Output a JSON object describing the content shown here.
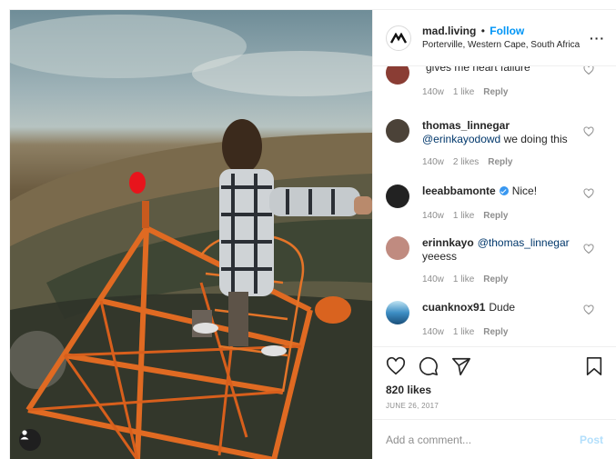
{
  "header": {
    "username": "mad.living",
    "separator": "•",
    "follow_label": "Follow",
    "location": "Porterville, Western Cape, South Africa",
    "more_label": "···"
  },
  "comments": [
    {
      "username": "",
      "text": "gives me heart failure",
      "mention": "",
      "age": "140w",
      "likes": "1 like",
      "reply_label": "Reply",
      "avatar_color": "#8a3d34"
    },
    {
      "username": "thomas_linnegar",
      "text": "we doing this",
      "mention": "@erinkayodowd",
      "age": "140w",
      "likes": "2 likes",
      "reply_label": "Reply",
      "avatar_color": "#4b4238"
    },
    {
      "username": "leeabbamonte",
      "text": "Nice!",
      "mention": "",
      "age": "140w",
      "likes": "1 like",
      "reply_label": "Reply",
      "avatar_color": "#222222"
    },
    {
      "username": "erinnkayo",
      "text": "yeeess",
      "mention": "@thomas_linnegar",
      "age": "140w",
      "likes": "1 like",
      "reply_label": "Reply",
      "avatar_color": "#c08b80"
    },
    {
      "username": "cuanknox91",
      "text": "Dude",
      "mention": "",
      "age": "140w",
      "likes": "1 like",
      "reply_label": "Reply",
      "avatar_color": "#2a78b3"
    }
  ],
  "likes_label": "820 likes",
  "date": "JUNE 26, 2017",
  "comment_input": {
    "placeholder": "Add a comment...",
    "value": ""
  },
  "post_button_label": "Post",
  "colors": {
    "accent": "#0095f6",
    "mention": "#00376b",
    "muted": "#8e8e8e",
    "post_disabled": "#b2dffc"
  }
}
